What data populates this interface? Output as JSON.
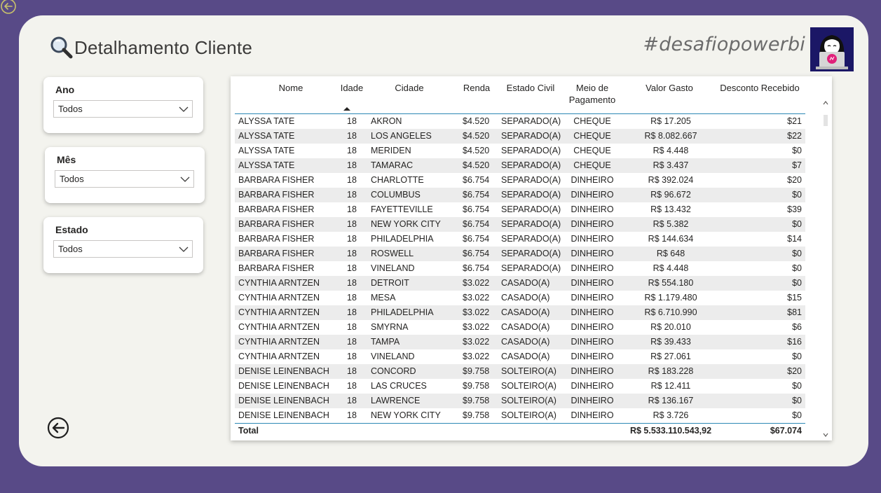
{
  "header": {
    "title": "Detalhamento Cliente",
    "hashtag": "#desafiopowerbi"
  },
  "filters": [
    {
      "label": "Ano",
      "value": "Todos"
    },
    {
      "label": "Mês",
      "value": "Todos"
    },
    {
      "label": "Estado",
      "value": "Todos"
    }
  ],
  "table": {
    "columns": {
      "nome": "Nome",
      "idade": "Idade",
      "cidade": "Cidade",
      "renda": "Renda",
      "estado_civil": "Estado Civil",
      "meio_line1": "Meio de",
      "meio_line2": "Pagamento",
      "valor_gasto": "Valor Gasto",
      "desconto": "Desconto Recebido"
    },
    "rows": [
      [
        "ALYSSA TATE",
        "18",
        "AKRON",
        "$4.520",
        "SEPARADO(A)",
        "CHEQUE",
        "R$ 17.205",
        "$21"
      ],
      [
        "ALYSSA TATE",
        "18",
        "LOS ANGELES",
        "$4.520",
        "SEPARADO(A)",
        "CHEQUE",
        "R$ 8.082.667",
        "$22"
      ],
      [
        "ALYSSA TATE",
        "18",
        "MERIDEN",
        "$4.520",
        "SEPARADO(A)",
        "CHEQUE",
        "R$ 4.448",
        "$0"
      ],
      [
        "ALYSSA TATE",
        "18",
        "TAMARAC",
        "$4.520",
        "SEPARADO(A)",
        "CHEQUE",
        "R$ 3.437",
        "$7"
      ],
      [
        "BARBARA FISHER",
        "18",
        "CHARLOTTE",
        "$6.754",
        "SEPARADO(A)",
        "DINHEIRO",
        "R$ 392.024",
        "$20"
      ],
      [
        "BARBARA FISHER",
        "18",
        "COLUMBUS",
        "$6.754",
        "SEPARADO(A)",
        "DINHEIRO",
        "R$ 96.672",
        "$0"
      ],
      [
        "BARBARA FISHER",
        "18",
        "FAYETTEVILLE",
        "$6.754",
        "SEPARADO(A)",
        "DINHEIRO",
        "R$ 13.432",
        "$39"
      ],
      [
        "BARBARA FISHER",
        "18",
        "NEW YORK CITY",
        "$6.754",
        "SEPARADO(A)",
        "DINHEIRO",
        "R$ 5.382",
        "$0"
      ],
      [
        "BARBARA FISHER",
        "18",
        "PHILADELPHIA",
        "$6.754",
        "SEPARADO(A)",
        "DINHEIRO",
        "R$ 144.634",
        "$14"
      ],
      [
        "BARBARA FISHER",
        "18",
        "ROSWELL",
        "$6.754",
        "SEPARADO(A)",
        "DINHEIRO",
        "R$ 648",
        "$0"
      ],
      [
        "BARBARA FISHER",
        "18",
        "VINELAND",
        "$6.754",
        "SEPARADO(A)",
        "DINHEIRO",
        "R$ 4.448",
        "$0"
      ],
      [
        "CYNTHIA ARNTZEN",
        "18",
        "DETROIT",
        "$3.022",
        "CASADO(A)",
        "DINHEIRO",
        "R$ 554.180",
        "$0"
      ],
      [
        "CYNTHIA ARNTZEN",
        "18",
        "MESA",
        "$3.022",
        "CASADO(A)",
        "DINHEIRO",
        "R$ 1.179.480",
        "$15"
      ],
      [
        "CYNTHIA ARNTZEN",
        "18",
        "PHILADELPHIA",
        "$3.022",
        "CASADO(A)",
        "DINHEIRO",
        "R$ 6.710.990",
        "$81"
      ],
      [
        "CYNTHIA ARNTZEN",
        "18",
        "SMYRNA",
        "$3.022",
        "CASADO(A)",
        "DINHEIRO",
        "R$ 20.010",
        "$6"
      ],
      [
        "CYNTHIA ARNTZEN",
        "18",
        "TAMPA",
        "$3.022",
        "CASADO(A)",
        "DINHEIRO",
        "R$ 39.433",
        "$16"
      ],
      [
        "CYNTHIA ARNTZEN",
        "18",
        "VINELAND",
        "$3.022",
        "CASADO(A)",
        "DINHEIRO",
        "R$ 27.061",
        "$0"
      ],
      [
        "DENISE LEINENBACH",
        "18",
        "CONCORD",
        "$9.758",
        "SOLTEIRO(A)",
        "DINHEIRO",
        "R$ 183.228",
        "$20"
      ],
      [
        "DENISE LEINENBACH",
        "18",
        "LAS CRUCES",
        "$9.758",
        "SOLTEIRO(A)",
        "DINHEIRO",
        "R$ 12.411",
        "$0"
      ],
      [
        "DENISE LEINENBACH",
        "18",
        "LAWRENCE",
        "$9.758",
        "SOLTEIRO(A)",
        "DINHEIRO",
        "R$ 136.167",
        "$0"
      ],
      [
        "DENISE LEINENBACH",
        "18",
        "NEW YORK CITY",
        "$9.758",
        "SOLTEIRO(A)",
        "DINHEIRO",
        "R$ 3.726",
        "$0"
      ]
    ],
    "total": {
      "label": "Total",
      "valor_gasto": "R$ 5.533.110.543,92",
      "desconto": "$67.074"
    }
  },
  "colors": {
    "background": "#584a87",
    "card": "#f3f3ee",
    "accent_line": "#2c88b5",
    "avatar_bg": "#1b1766"
  },
  "icons": [
    "back-arrow-icon",
    "magnifier-icon",
    "chevron-down-icon",
    "sort-ascending-icon",
    "scroll-up-icon",
    "scroll-down-icon",
    "avatar-illustration"
  ]
}
